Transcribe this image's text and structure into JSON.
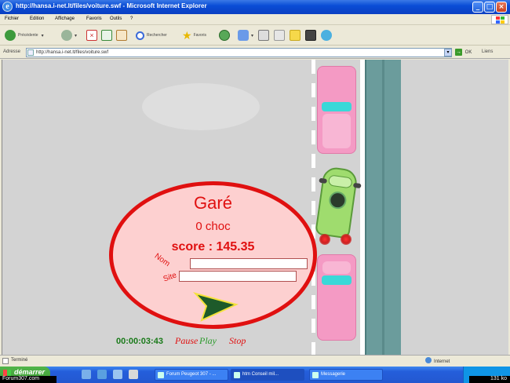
{
  "window": {
    "title": "http://hansa.i-net.lt/files/voiture.swf - Microsoft Internet Explorer"
  },
  "menu": [
    "Fichier",
    "Edition",
    "Affichage",
    "Favoris",
    "Outils",
    "?"
  ],
  "toolbar": {
    "back_label": "Précédente",
    "search_label": "Rechercher",
    "favorites_label": "Favoris"
  },
  "address": {
    "label": "Adresse",
    "value": "http://hansa.i-net.lt/files/voiture.swf",
    "go_label": "OK",
    "links_label": "Liens"
  },
  "game": {
    "result_title": "Garé",
    "shocks": "0 choc",
    "score": "score : 145.35",
    "name_label": "Nom",
    "site_label": "Site",
    "name_value": "",
    "site_value": "",
    "timer": "00:00:03:43",
    "pause_label": "Pause",
    "play_label": "Play",
    "stop_label": "Stop"
  },
  "statusbar": {
    "left": "Terminé",
    "zone": "Internet"
  },
  "taskbar": {
    "start_label": "démarrer",
    "watermark": "Forum307.com",
    "tasks": [
      "Forum Peugeot 307 - ...",
      "htm Conseil mil...",
      "Messagerie"
    ],
    "size": "131 ko"
  },
  "colors": {
    "ellipse_border": "#e01010",
    "ellipse_fill": "#fdd0d0",
    "pink_car": "#f49ac4",
    "green_car": "#9fdc6e",
    "sidewalk": "#6b9c9c",
    "timer": "#1a7a1a"
  },
  "icons": [
    "ie-icon",
    "back-icon",
    "forward-icon",
    "stop-icon",
    "refresh-icon",
    "home-icon",
    "search-icon",
    "favorites-icon",
    "history-icon",
    "mail-icon",
    "print-icon",
    "edit-icon",
    "discuss-icon",
    "messenger-icon",
    "go-icon",
    "globe-icon",
    "windows-flag-icon"
  ]
}
